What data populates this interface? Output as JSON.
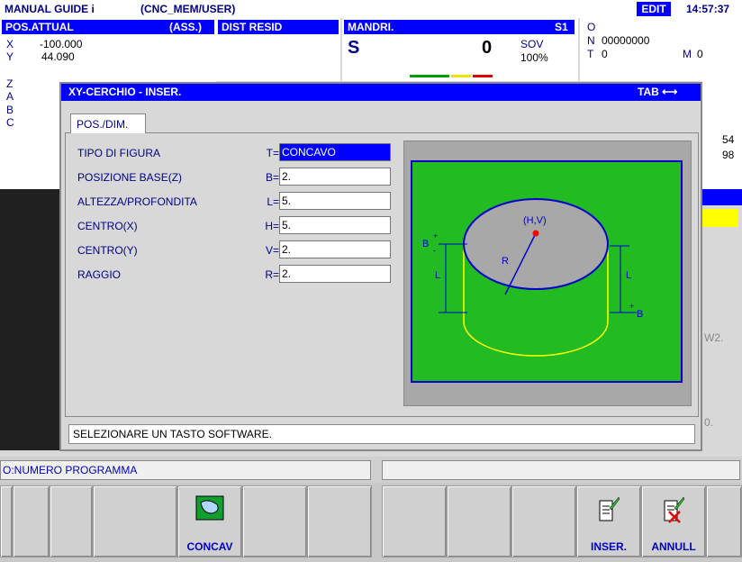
{
  "title_bar": {
    "app": "MANUAL GUIDE i",
    "path": "(CNC_MEM/USER)",
    "mode": "EDIT",
    "time": "14:57:37"
  },
  "pos_panel": {
    "title": "POS.ATTUAL",
    "abs": "(ASS.)",
    "axes": [
      {
        "label": "X",
        "value": "-100.000"
      },
      {
        "label": "Y",
        "value": "44.090"
      },
      {
        "label": "Z",
        "value": ""
      },
      {
        "label": "A",
        "value": ""
      },
      {
        "label": "B",
        "value": ""
      },
      {
        "label": "C",
        "value": ""
      }
    ]
  },
  "dist_resid": {
    "title": "DIST RESID"
  },
  "spindle": {
    "title": "MANDRI.",
    "id": "S1",
    "s_label": "S",
    "s_value": "0",
    "sov_label": "SOV",
    "sov_value": "100%"
  },
  "onm": {
    "o_label": "O",
    "n_label": "N",
    "n_value": "00000000",
    "t_label": "T",
    "t_value": "0",
    "m_label": "M",
    "m_value": "0"
  },
  "side_values": {
    "v1": "54",
    "v2": "98",
    "w2": "W2.",
    "o0": "0."
  },
  "dialog": {
    "title": "XY-CERCHIO - INSER.",
    "tab_label": "TAB ⟷",
    "tab": "POS./DIM.",
    "fields": [
      {
        "label": "TIPO DI FIGURA",
        "letter": "T=",
        "value": "CONCAVO"
      },
      {
        "label": "POSIZIONE BASE(Z)",
        "letter": "B=",
        "value": "2."
      },
      {
        "label": "ALTEZZA/PROFONDITA",
        "letter": "L=",
        "value": "5."
      },
      {
        "label": "CENTRO(X)",
        "letter": "H=",
        "value": "5."
      },
      {
        "label": "CENTRO(Y)",
        "letter": "V=",
        "value": "2."
      },
      {
        "label": "RAGGIO",
        "letter": "R=",
        "value": "2."
      }
    ],
    "diagram": {
      "hv": "(H,V)",
      "r": "R",
      "b_left": "B",
      "b_right": "B",
      "l_left": "L",
      "l_right": "L",
      "plus": "+",
      "minus": "-"
    },
    "message": "SELEZIONARE UN TASTO SOFTWARE."
  },
  "bottom_status": {
    "left": "O:NUMERO PROGRAMMA",
    "right": ""
  },
  "softkeys": [
    "",
    "",
    "",
    "CONCAV",
    "",
    "",
    "",
    "",
    "",
    "INSER.",
    "ANNULL",
    ""
  ]
}
